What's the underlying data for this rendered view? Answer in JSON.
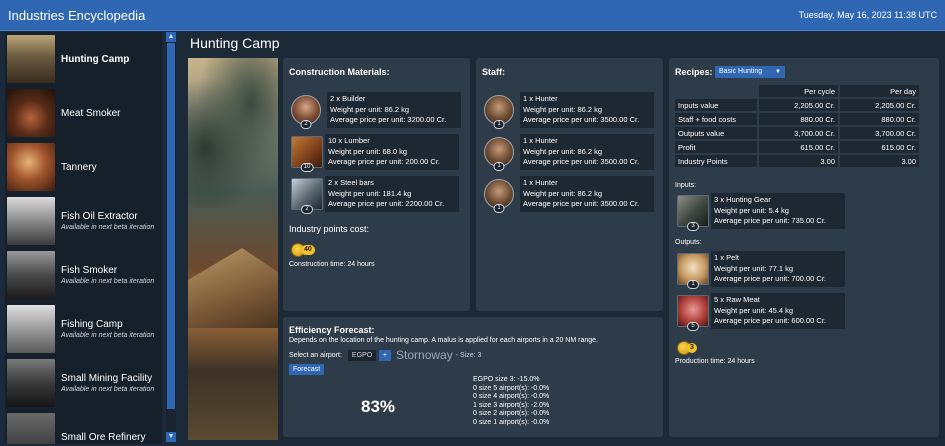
{
  "window": {
    "title": "Industries Encyclopedia",
    "datetime": "Tuesday, May 16, 2023 11:38 UTC"
  },
  "sidebar": {
    "items": [
      {
        "label": "Hunting Camp",
        "sub": "",
        "active": true
      },
      {
        "label": "Meat Smoker",
        "sub": ""
      },
      {
        "label": "Tannery",
        "sub": ""
      },
      {
        "label": "Fish Oil Extractor",
        "sub": "Available in next beta iteration"
      },
      {
        "label": "Fish Smoker",
        "sub": "Available in next beta iteration"
      },
      {
        "label": "Fishing Camp",
        "sub": "Available in next beta iteration"
      },
      {
        "label": "Small Mining Facility",
        "sub": "Available in next beta iteration"
      },
      {
        "label": "Small Ore Refinery",
        "sub": ""
      }
    ]
  },
  "main": {
    "title": "Hunting Camp"
  },
  "construction": {
    "title": "Construction Materials:",
    "items": [
      {
        "qty_label": "2 x Builder",
        "weight": "Weight per unit: 86.2 kg",
        "price": "Average price per unit: 3200.00 Cr.",
        "badge": "2",
        "icon": "builder-portrait-icon"
      },
      {
        "qty_label": "10 x Lumber",
        "weight": "Weight per unit: 68.0 kg",
        "price": "Average price per unit: 200.00 Cr.",
        "badge": "10",
        "icon": "lumber-icon"
      },
      {
        "qty_label": "2 x Steel bars",
        "weight": "Weight per unit: 181.4 kg",
        "price": "Average price per unit: 2200.00 Cr.",
        "badge": "2",
        "icon": "steel-bars-icon"
      }
    ],
    "points_label": "Industry points cost:",
    "points_value": "40",
    "time": "Construction time: 24 hours"
  },
  "staff": {
    "title": "Staff:",
    "items": [
      {
        "qty_label": "1 x Hunter",
        "weight": "Weight per unit: 86.2 kg",
        "price": "Average price per unit: 3500.00 Cr.",
        "badge": "1"
      },
      {
        "qty_label": "1 x Hunter",
        "weight": "Weight per unit: 86.2 kg",
        "price": "Average price per unit: 3500.00 Cr.",
        "badge": "1"
      },
      {
        "qty_label": "1 x Hunter",
        "weight": "Weight per unit: 86.2 kg",
        "price": "Average price per unit: 3500.00 Cr.",
        "badge": "1"
      }
    ]
  },
  "recipes": {
    "title": "Recipes:",
    "selected": "Basic Hunting",
    "columns": [
      "Per cycle",
      "Per day"
    ],
    "rows": [
      {
        "label": "Inputs value",
        "cycle": "2,205.00 Cr.",
        "day": "2,205.00 Cr."
      },
      {
        "label": "Staff + food costs",
        "cycle": "880.00 Cr.",
        "day": "880.00 Cr."
      },
      {
        "label": "Outputs value",
        "cycle": "3,700.00 Cr.",
        "day": "3,700.00 Cr."
      },
      {
        "label": "Profit",
        "cycle": "615.00 Cr.",
        "day": "615.00 Cr."
      },
      {
        "label": "Industry Points",
        "cycle": "3.00",
        "day": "3.00"
      }
    ],
    "inputs_label": "Inputs:",
    "inputs": [
      {
        "qty_label": "3 x Hunting Gear",
        "weight": "Weight per unit: 5.4 kg",
        "price": "Average price per unit: 735.00 Cr.",
        "badge": "3"
      }
    ],
    "outputs_label": "Outputs:",
    "outputs": [
      {
        "qty_label": "1 x Pelt",
        "weight": "Weight per unit: 77.1 kg",
        "price": "Average price per unit: 700.00 Cr.",
        "badge": "1"
      },
      {
        "qty_label": "5 x Raw Meat",
        "weight": "Weight per unit: 45.4 kg",
        "price": "Average price per unit: 600.00 Cr.",
        "badge": "5"
      }
    ],
    "points_value": "3",
    "time": "Production time: 24 hours"
  },
  "efficiency": {
    "title": "Efficiency Forecast:",
    "description": "Depends on the location of the hunting camp. A malus is applied for each airports in a 20 NM range.",
    "airport_label": "Select an airport:",
    "airport_code": "EGPO",
    "add_label": "+",
    "airport_name": "Stornoway",
    "airport_size": "- Size: 3",
    "forecast_button": "Forecast",
    "percent": "83%",
    "breakdown": [
      "EGPO size 3: -15.0%",
      "0 size 5 airport(s): -0.0%",
      "0 size 4 airport(s): -0.0%",
      "1 size 3 airport(s): -2.0%",
      "0 size 2 airport(s): -0.0%",
      "0 size 1 airport(s): -0.0%"
    ]
  }
}
